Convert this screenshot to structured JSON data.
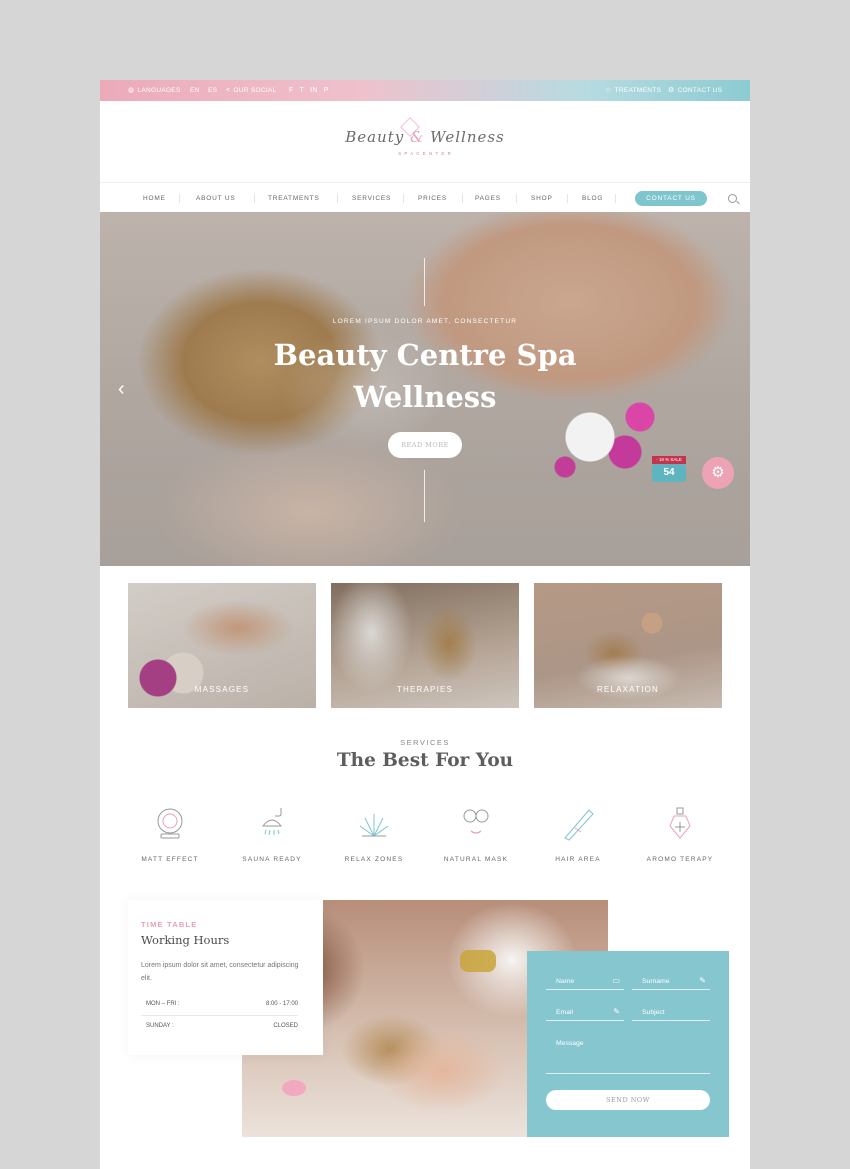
{
  "topbar": {
    "languages": "LANGUAGES",
    "lang_en": "EN",
    "lang_es": "ES",
    "our_social": "OUR SOCIAL",
    "social_icons": [
      "facebook-icon",
      "twitter-icon",
      "linkedin-icon",
      "pinterest-icon"
    ],
    "treatments": "TREATMENTS",
    "contact_us": "CONTACT US"
  },
  "logo": {
    "script": "Beauty",
    "amp": "&",
    "script2": "Wellness",
    "sub": "S P A   C E N T E R"
  },
  "nav": {
    "items": [
      "HOME",
      "ABOUT US",
      "TREATMENTS",
      "SERVICES",
      "PRICES",
      "PAGES",
      "SHOP",
      "BLOG"
    ],
    "contact": "CONTACT US"
  },
  "hero": {
    "eyebrow": "LOREM IPSUM DOLOR AMET, CONSECTETUR",
    "title_line1": "Beauty Centre Spa",
    "title_line2": "Wellness",
    "button": "READ MORE",
    "sale": "- 18 % SALE",
    "price": "54"
  },
  "tiles": [
    "MASSAGES",
    "THERAPIES",
    "RELAXATION"
  ],
  "services": {
    "eyebrow": "SERVICES",
    "title": "The Best For You",
    "items": [
      "MATT EFFECT",
      "SAUNA READY",
      "RELAX ZONES",
      "NATURAL MASK",
      "HAIR AREA",
      "AROMO TERAPY"
    ]
  },
  "timetable": {
    "eyebrow": "TIME TABLE",
    "title": "Working Hours",
    "desc": "Lorem ipsum dolor sit amet, consectetur adipiscing elit.",
    "rows": [
      {
        "day": "MON – FRI :",
        "hours": "8:00 - 17:00"
      },
      {
        "day": "SUNDAY :",
        "hours": "CLOSED"
      }
    ]
  },
  "form": {
    "name": "Name",
    "surname": "Surname",
    "email": "Email",
    "subject": "Subject",
    "message": "Message",
    "send": "SEND NOW"
  },
  "colors": {
    "pink": "#eda3b5",
    "teal": "#86c7cf"
  }
}
